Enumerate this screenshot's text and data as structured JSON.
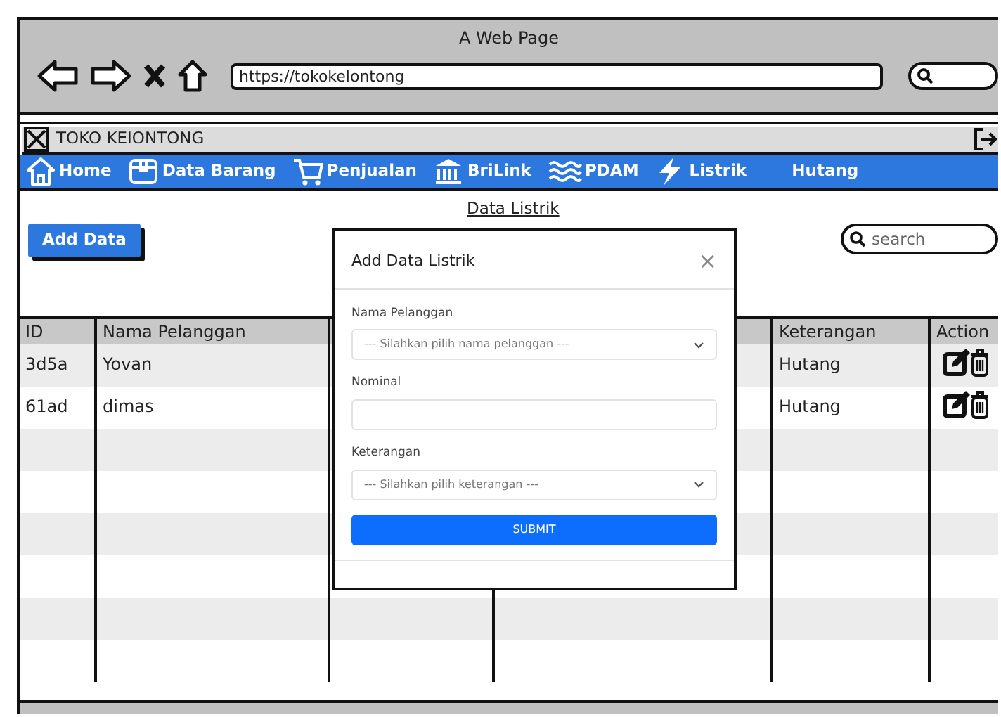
{
  "browser": {
    "title": "A Web Page",
    "url": "https://tokokelontong"
  },
  "app": {
    "title": "TOKO KEIONTONG"
  },
  "nav": [
    "Home",
    "Data Barang",
    "Penjualan",
    "BriLink",
    "PDAM",
    "Listrik",
    "Hutang"
  ],
  "page_title": "Data Listrik",
  "add_button": "Add Data",
  "search": {
    "placeholder": "search"
  },
  "table": {
    "columns": [
      "ID",
      "Nama Pelanggan",
      "Keterangan",
      "Action"
    ],
    "rows": [
      {
        "id": "3d5a",
        "nama_pelanggan": "Yovan",
        "keterangan": "Hutang"
      },
      {
        "id": "61ad",
        "nama_pelanggan": "dimas",
        "keterangan": "Hutang"
      }
    ]
  },
  "modal": {
    "title": "Add Data Listrik",
    "close": "×",
    "fields": [
      {
        "kind": "select",
        "label": "Nama Pelanggan",
        "placeholder": "--- Silahkan pilih nama pelanggan ---"
      },
      {
        "kind": "input",
        "label": "Nominal"
      },
      {
        "kind": "select",
        "label": "Keterangan",
        "placeholder": "--- Silahkan pilih keterangan ---"
      }
    ],
    "submit": "SUBMIT"
  }
}
